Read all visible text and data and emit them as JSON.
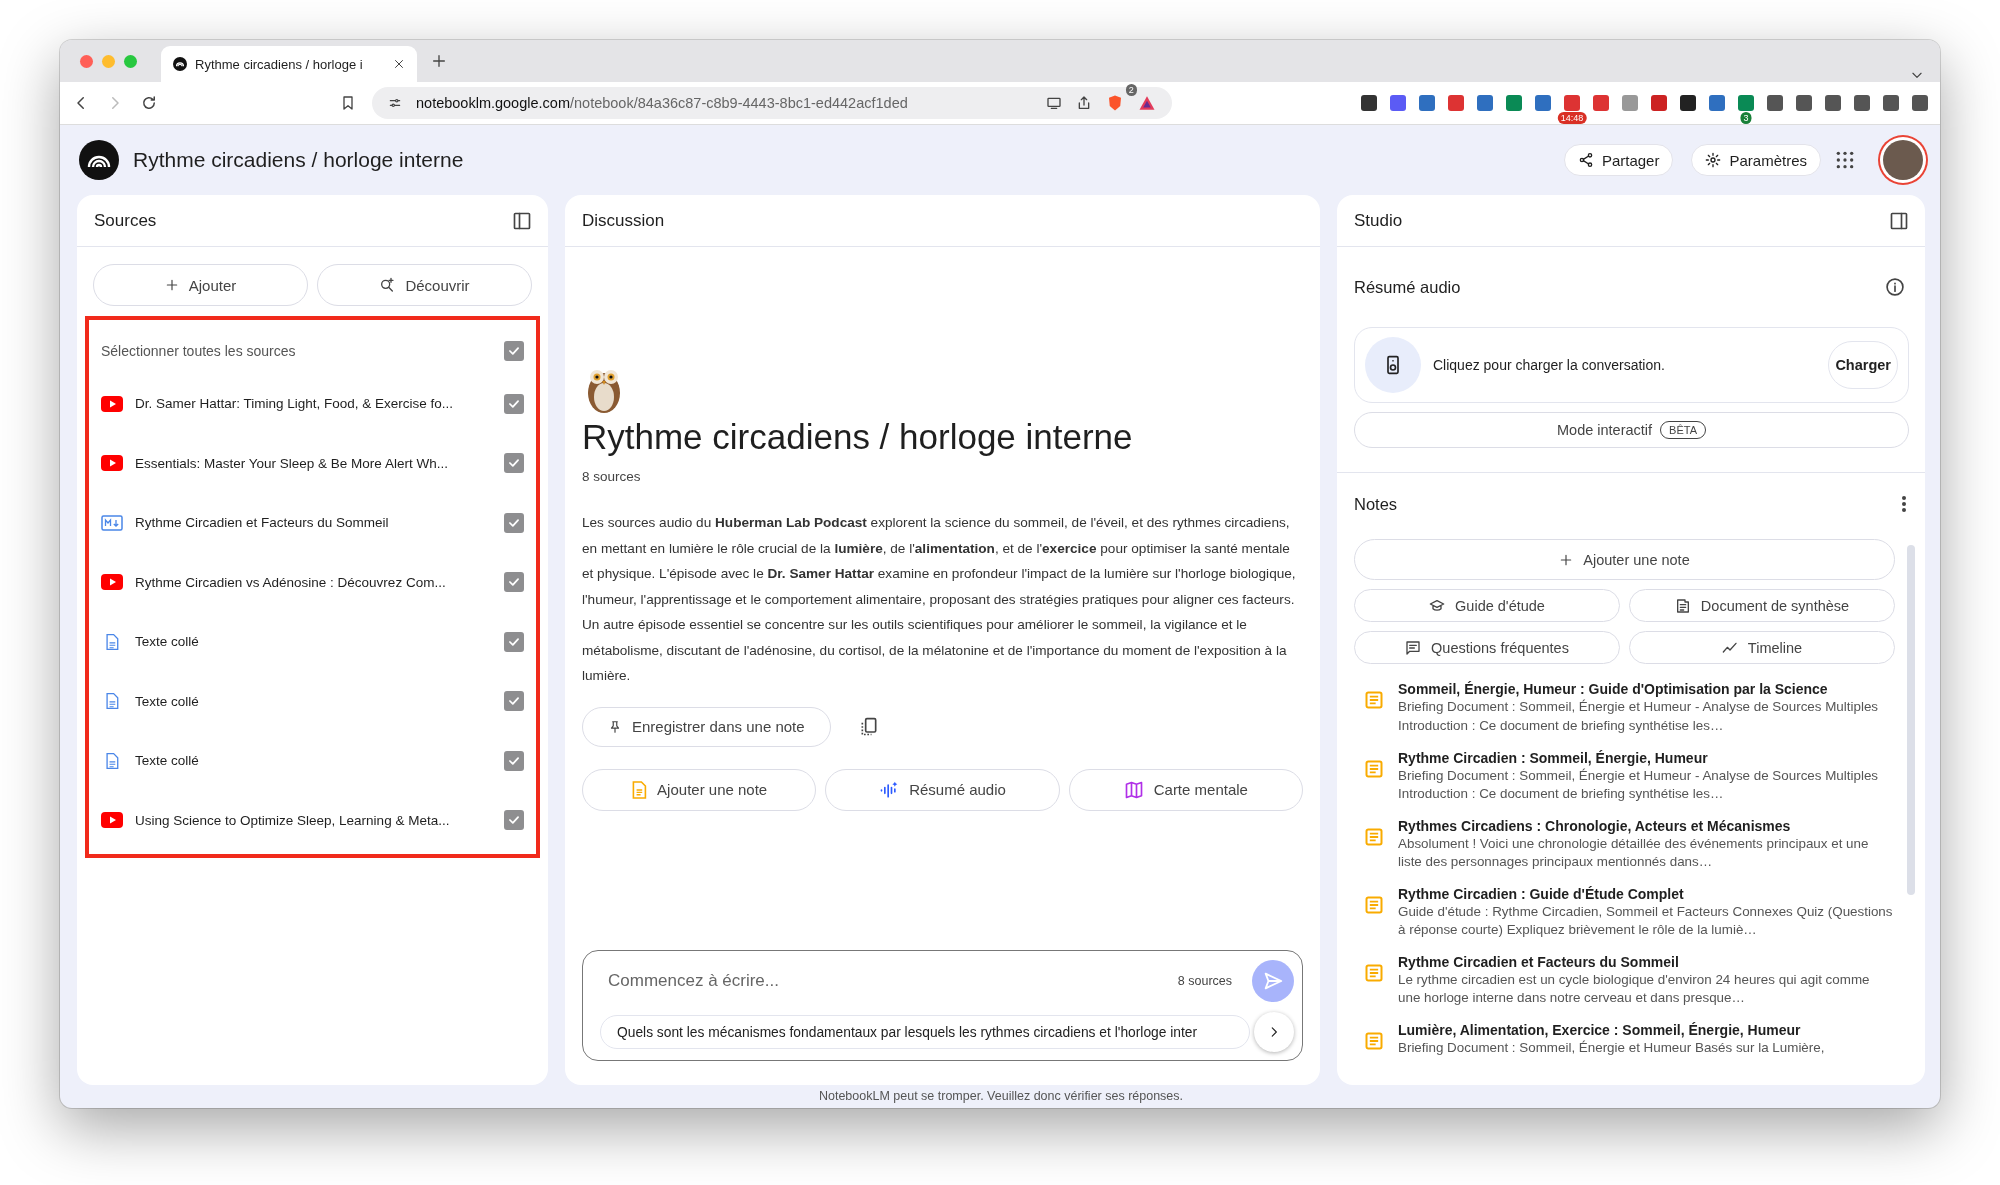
{
  "browser": {
    "tab": {
      "title": "Rythme circadiens / horloge i"
    },
    "url": {
      "host": "notebooklm.google.com",
      "path": "/notebook/84a36c87-c8b9-4443-8bc1-ed442acf1ded"
    },
    "shield_badge": "2",
    "extensions": [
      {
        "kind": "text"
      },
      {
        "kind": "star"
      },
      {
        "kind": "terminal"
      },
      {
        "kind": "blocked"
      },
      {
        "kind": "columns"
      },
      {
        "kind": "record"
      },
      {
        "kind": "timer"
      },
      {
        "kind": "calendar",
        "badge": "14:48"
      },
      {
        "kind": "play"
      },
      {
        "kind": "camera"
      },
      {
        "kind": "forward"
      },
      {
        "kind": "mask"
      },
      {
        "kind": "reader"
      },
      {
        "kind": "teams",
        "badge": "3"
      },
      {
        "kind": "puzzle"
      },
      {
        "kind": "sidebar"
      },
      {
        "kind": "wallet"
      },
      {
        "kind": "sparkle"
      },
      {
        "kind": "shield"
      },
      {
        "kind": "menu"
      }
    ]
  },
  "app": {
    "title": "Rythme circadiens / horloge interne",
    "share_button": "Partager",
    "settings_button": "Paramètres"
  },
  "sources": {
    "title": "Sources",
    "add_button": "Ajouter",
    "discover_button": "Découvrir",
    "select_all": {
      "label": "Sélectionner toutes les sources",
      "checked": true
    },
    "items": [
      {
        "kind": "youtube",
        "title": "Dr. Samer Hattar: Timing Light, Food, & Exercise fo...",
        "checked": true
      },
      {
        "kind": "youtube",
        "title": "Essentials: Master Your Sleep & Be More Alert Wh...",
        "checked": true
      },
      {
        "kind": "markdown",
        "title": "Rythme Circadien et Facteurs du Sommeil",
        "checked": true
      },
      {
        "kind": "youtube",
        "title": "Rythme Circadien vs Adénosine : Découvrez Com...",
        "checked": true
      },
      {
        "kind": "text",
        "title": "Texte collé",
        "checked": true
      },
      {
        "kind": "text",
        "title": "Texte collé",
        "checked": true
      },
      {
        "kind": "text",
        "title": "Texte collé",
        "checked": true
      },
      {
        "kind": "youtube",
        "title": "Using Science to Optimize Sleep, Learning & Meta...",
        "checked": true
      }
    ]
  },
  "discussion": {
    "title": "Discussion",
    "notebook_title": "Rythme circadiens / horloge interne",
    "source_count": "8 sources",
    "summary": "Les sources audio du **Huberman Lab Podcast** explorent la science du sommeil, de l'éveil, et des rythmes circadiens, en mettant en lumière le rôle crucial de la **lumière**, de l'**alimentation**, et de l'**exercice** pour optimiser la santé mentale et physique. L'épisode avec le **Dr. Samer Hattar** examine en profondeur l'impact de la lumière sur l'horloge biologique, l'humeur, l'apprentissage et le comportement alimentaire, proposant des stratégies pratiques pour aligner ces facteurs. Un autre épisode essentiel se concentre sur les outils scientifiques pour améliorer le sommeil, la vigilance et le métabolisme, discutant de l'adénosine, du cortisol, de la mélatonine et de l'importance du moment de l'exposition à la lumière.",
    "save_button": "Enregistrer dans une note",
    "quick_actions": [
      {
        "kind": "note",
        "label": "Ajouter une note"
      },
      {
        "kind": "audio",
        "label": "Résumé audio"
      },
      {
        "kind": "map",
        "label": "Carte mentale"
      }
    ],
    "input": {
      "placeholder": "Commencez à écrire...",
      "source_count": "8 sources",
      "suggestion": "Quels sont les mécanismes fondamentaux par lesquels les rythmes circadiens et l'horloge inter"
    }
  },
  "studio": {
    "title": "Studio",
    "audio": {
      "title": "Résumé audio",
      "card_text": "Cliquez pour charger la conversation.",
      "load_button": "Charger",
      "interactive_button": "Mode interactif",
      "interactive_badge": "BÊTA"
    },
    "notes": {
      "title": "Notes",
      "add_button": "Ajouter une note",
      "actions": [
        {
          "kind": "study",
          "label": "Guide d'étude"
        },
        {
          "kind": "briefing",
          "label": "Document de synthèse"
        },
        {
          "kind": "faq",
          "label": "Questions fréquentes"
        },
        {
          "kind": "timeline",
          "label": "Timeline"
        }
      ],
      "items": [
        {
          "title": "Sommeil, Énergie, Humeur : Guide d'Optimisation par la Science",
          "description": "Briefing Document : Sommeil, Énergie et Humeur - Analyse de Sources Multiples Introduction : Ce document de briefing synthétise les…"
        },
        {
          "title": "Rythme Circadien : Sommeil, Énergie, Humeur",
          "description": "Briefing Document : Sommeil, Énergie et Humeur - Analyse de Sources Multiples Introduction : Ce document de briefing synthétise les…"
        },
        {
          "title": "Rythmes Circadiens : Chronologie, Acteurs et Mécanismes",
          "description": "Absolument ! Voici une chronologie détaillée des événements principaux et une liste des personnages principaux mentionnés dans…"
        },
        {
          "title": "Rythme Circadien : Guide d'Étude Complet",
          "description": "Guide d'étude : Rythme Circadien, Sommeil et Facteurs Connexes Quiz (Questions à réponse courte) Expliquez brièvement le rôle de la lumiè…"
        },
        {
          "title": "Rythme Circadien et Facteurs du Sommeil",
          "description": "Le rythme circadien est un cycle biologique d'environ 24 heures qui agit comme une horloge interne dans notre cerveau et dans presque…"
        },
        {
          "title": "Lumière, Alimentation, Exercice : Sommeil, Énergie, Humeur",
          "description": "Briefing Document : Sommeil, Énergie et Humeur Basés sur la Lumière,"
        }
      ]
    }
  },
  "footer": "NotebookLM peut se tromper. Veuillez donc vérifier ses réponses."
}
